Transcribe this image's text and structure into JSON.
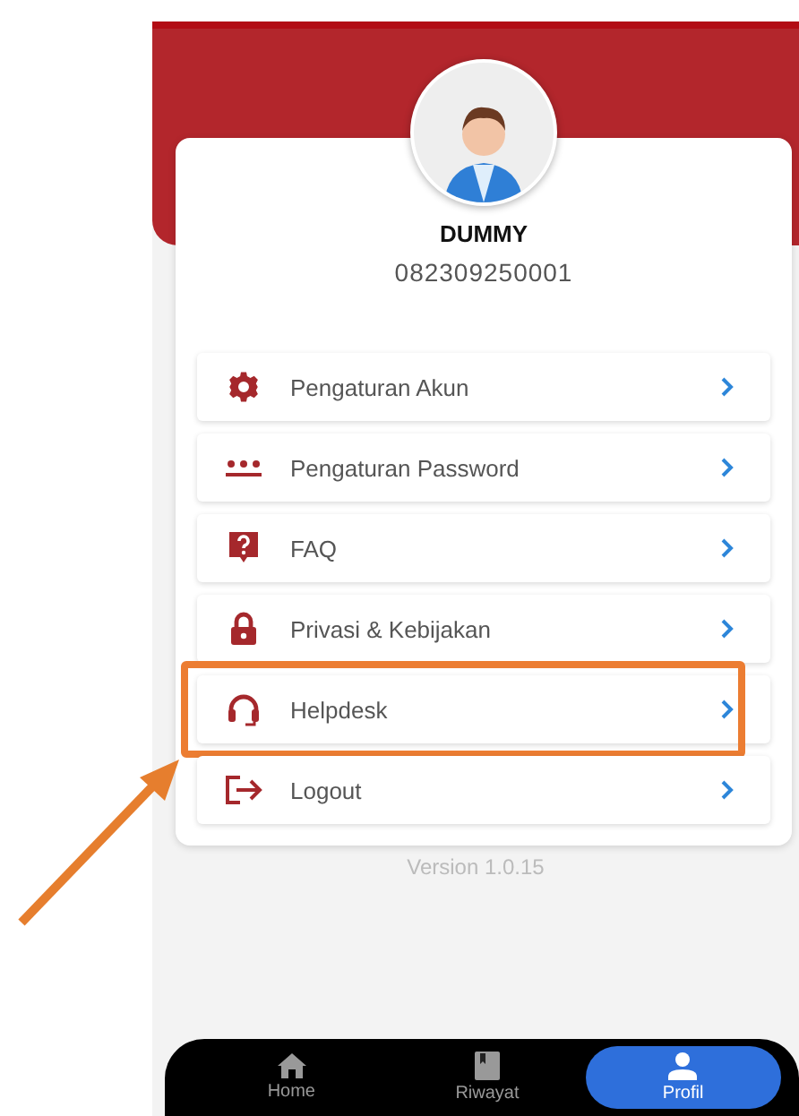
{
  "profile": {
    "name": "DUMMY",
    "phone": "082309250001"
  },
  "menu": [
    {
      "kind": "gear",
      "label": "Pengaturan Akun",
      "highlighted": false
    },
    {
      "kind": "password",
      "label": "Pengaturan Password",
      "highlighted": false
    },
    {
      "kind": "faq",
      "label": "FAQ",
      "highlighted": false
    },
    {
      "kind": "lock",
      "label": "Privasi & Kebijakan",
      "highlighted": false
    },
    {
      "kind": "headset",
      "label": "Helpdesk",
      "highlighted": true
    },
    {
      "kind": "logout",
      "label": "Logout",
      "highlighted": false
    }
  ],
  "version": "Version 1.0.15",
  "bottom_nav": [
    {
      "kind": "home",
      "label": "Home",
      "selected": false
    },
    {
      "kind": "book",
      "label": "Riwayat",
      "selected": false
    },
    {
      "kind": "person",
      "label": "Profil",
      "selected": true
    }
  ]
}
